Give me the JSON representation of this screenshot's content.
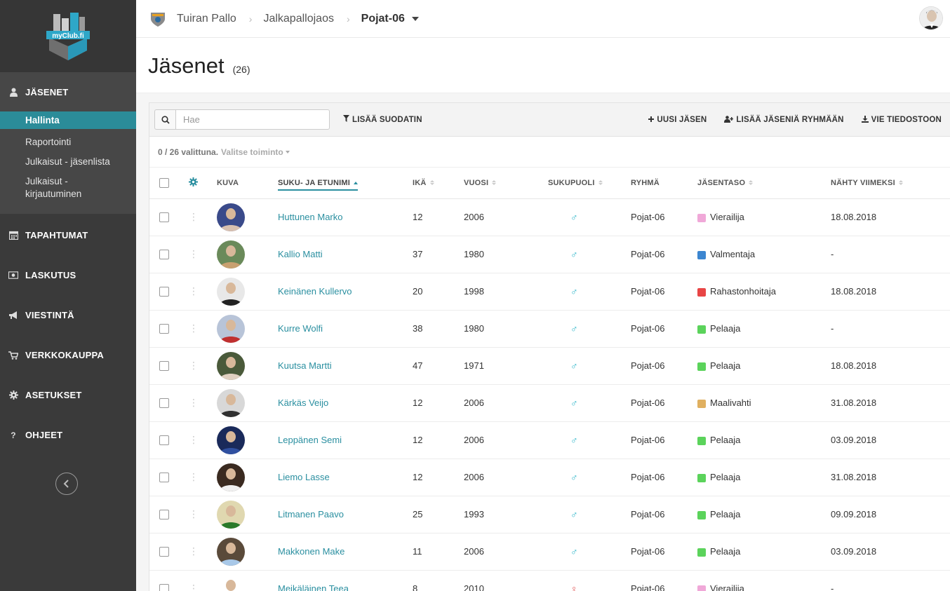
{
  "sidebar": {
    "logo_text": "myClub.fi",
    "section": {
      "title": "JÄSENET",
      "icon": "user-icon",
      "items": [
        {
          "label": "Hallinta",
          "active": true
        },
        {
          "label": "Raportointi"
        },
        {
          "label": "Julkaisut - jäsenlista"
        },
        {
          "label": "Julkaisut - kirjautuminen"
        }
      ]
    },
    "main_items": [
      {
        "label": "TAPAHTUMAT",
        "icon": "calendar-icon"
      },
      {
        "label": "LASKUTUS",
        "icon": "money-icon"
      },
      {
        "label": "VIESTINTÄ",
        "icon": "megaphone-icon"
      },
      {
        "label": "VERKKOKAUPPA",
        "icon": "cart-icon"
      },
      {
        "label": "ASETUKSET",
        "icon": "gear-icon"
      },
      {
        "label": "OHJEET",
        "icon": "question-icon"
      }
    ]
  },
  "topbar": {
    "crumbs": [
      "Tuiran Pallo",
      "Jalkapallojaos",
      "Pojat-06"
    ]
  },
  "page": {
    "title": "Jäsenet",
    "count": "(26)"
  },
  "toolbar": {
    "search_placeholder": "Hae",
    "filter_label": "LISÄÄ SUODATIN",
    "new_member": "UUSI JÄSEN",
    "add_to_group": "LISÄÄ JÄSENIÄ RYHMÄÄN",
    "export": "VIE TIEDOSTOON"
  },
  "selection": {
    "count": "0 / 26 valittuna.",
    "action": "Valitse toiminto"
  },
  "table": {
    "headers": {
      "photo": "KUVA",
      "name": "SUKU- JA ETUNIMI",
      "age": "IKÄ",
      "year": "VUOSI",
      "gender": "SUKUPUOLI",
      "group": "RYHMÄ",
      "level": "JÄSENTASO",
      "seen": "NÄHTY VIIMEKSI"
    },
    "rows": [
      {
        "name": "Huttunen Marko",
        "age": "12",
        "year": "2006",
        "gender": "♂",
        "group": "Pojat-06",
        "level": "Vierailija",
        "level_color": "#f0a8d8",
        "seen": "18.08.2018",
        "photo": [
          "#3a4a8a",
          "#d8c0b0"
        ]
      },
      {
        "name": "Kallio Matti",
        "age": "37",
        "year": "1980",
        "gender": "♂",
        "group": "Pojat-06",
        "level": "Valmentaja",
        "level_color": "#3c86d0",
        "seen": "-",
        "photo": [
          "#6a8a5a",
          "#c8a070"
        ]
      },
      {
        "name": "Keinänen Kullervo",
        "age": "20",
        "year": "1998",
        "gender": "♂",
        "group": "Pojat-06",
        "level": "Rahastonhoitaja",
        "level_color": "#e84545",
        "seen": "18.08.2018",
        "photo": [
          "#e8e8e8",
          "#222222"
        ]
      },
      {
        "name": "Kurre Wolfi",
        "age": "38",
        "year": "1980",
        "gender": "♂",
        "group": "Pojat-06",
        "level": "Pelaaja",
        "level_color": "#5bd35b",
        "seen": "-",
        "photo": [
          "#b8c4d8",
          "#c03030"
        ]
      },
      {
        "name": "Kuutsa Martti",
        "age": "47",
        "year": "1971",
        "gender": "♂",
        "group": "Pojat-06",
        "level": "Pelaaja",
        "level_color": "#5bd35b",
        "seen": "18.08.2018",
        "photo": [
          "#4a5a3a",
          "#e0d0c0"
        ]
      },
      {
        "name": "Kärkäs Veijo",
        "age": "12",
        "year": "2006",
        "gender": "♂",
        "group": "Pojat-06",
        "level": "Maalivahti",
        "level_color": "#e0b060",
        "seen": "31.08.2018",
        "photo": [
          "#d8d8d8",
          "#303030"
        ]
      },
      {
        "name": "Leppänen Semi",
        "age": "12",
        "year": "2006",
        "gender": "♂",
        "group": "Pojat-06",
        "level": "Pelaaja",
        "level_color": "#5bd35b",
        "seen": "03.09.2018",
        "photo": [
          "#1a2a5a",
          "#3050a0"
        ]
      },
      {
        "name": "Liemo Lasse",
        "age": "12",
        "year": "2006",
        "gender": "♂",
        "group": "Pojat-06",
        "level": "Pelaaja",
        "level_color": "#5bd35b",
        "seen": "31.08.2018",
        "photo": [
          "#3a2a20",
          "#f0f0f0"
        ]
      },
      {
        "name": "Litmanen Paavo",
        "age": "25",
        "year": "1993",
        "gender": "♂",
        "group": "Pojat-06",
        "level": "Pelaaja",
        "level_color": "#5bd35b",
        "seen": "09.09.2018",
        "photo": [
          "#e0d8b0",
          "#2a7a2a"
        ]
      },
      {
        "name": "Makkonen Make",
        "age": "11",
        "year": "2006",
        "gender": "♂",
        "group": "Pojat-06",
        "level": "Pelaaja",
        "level_color": "#5bd35b",
        "seen": "03.09.2018",
        "photo": [
          "#5a4a3a",
          "#a8c8e8"
        ]
      },
      {
        "name": "Meikäläinen Teea",
        "age": "8",
        "year": "2010",
        "gender": "♀",
        "group": "Pojat-06",
        "level": "Vierailija",
        "level_color": "#f0a8d8",
        "seen": "-",
        "photo": [
          "#ffffff",
          "#777777"
        ]
      }
    ]
  }
}
